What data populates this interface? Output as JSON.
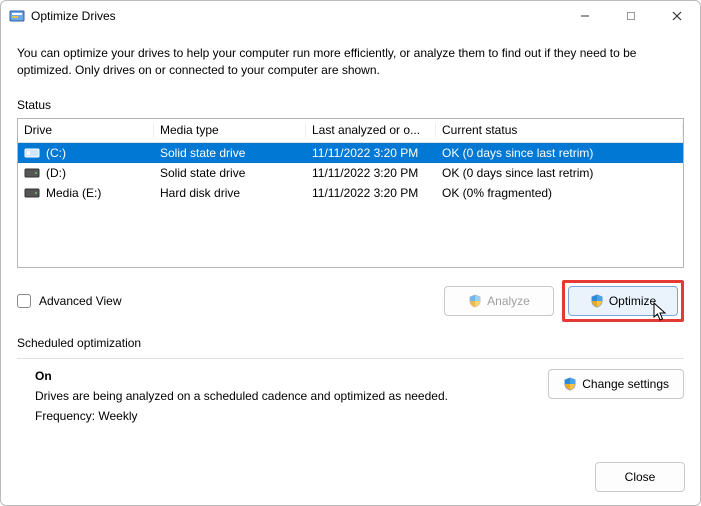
{
  "window": {
    "title": "Optimize Drives"
  },
  "description": "You can optimize your drives to help your computer run more efficiently, or analyze them to find out if they need to be optimized. Only drives on or connected to your computer are shown.",
  "status_label": "Status",
  "columns": {
    "drive": "Drive",
    "media": "Media type",
    "last": "Last analyzed or o...",
    "status": "Current status"
  },
  "drives": [
    {
      "name": "(C:)",
      "media": "Solid state drive",
      "last": "11/11/2022 3:20 PM",
      "status": "OK (0 days since last retrim)",
      "selected": true,
      "icon": "ssd"
    },
    {
      "name": "(D:)",
      "media": "Solid state drive",
      "last": "11/11/2022 3:20 PM",
      "status": "OK (0 days since last retrim)",
      "selected": false,
      "icon": "hdd"
    },
    {
      "name": "Media (E:)",
      "media": "Hard disk drive",
      "last": "11/11/2022 3:20 PM",
      "status": "OK (0% fragmented)",
      "selected": false,
      "icon": "hdd"
    }
  ],
  "advanced_view_label": "Advanced View",
  "buttons": {
    "analyze": "Analyze",
    "optimize": "Optimize",
    "change_settings": "Change settings",
    "close": "Close"
  },
  "scheduled": {
    "section": "Scheduled optimization",
    "on": "On",
    "line1": "Drives are being analyzed on a scheduled cadence and optimized as needed.",
    "line2": "Frequency: Weekly"
  }
}
